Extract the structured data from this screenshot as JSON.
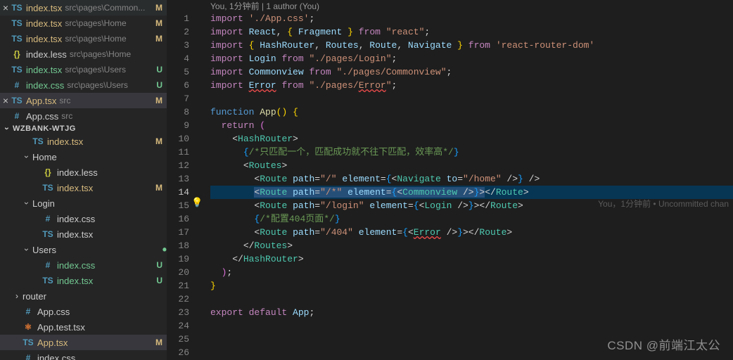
{
  "open_editors": [
    {
      "icon": "TS",
      "iconCls": "ico-ts",
      "name": "index.tsx",
      "path": "src\\pages\\Common...",
      "badge": "M",
      "status": "mod",
      "pad": 1
    },
    {
      "icon": "TS",
      "iconCls": "ico-ts",
      "name": "index.tsx",
      "path": "src\\pages\\Home",
      "badge": "M",
      "status": "mod",
      "pad": 1
    },
    {
      "icon": "TS",
      "iconCls": "ico-ts",
      "name": "index.tsx",
      "path": "src\\pages\\Home",
      "badge": "M",
      "status": "mod",
      "pad": 1
    },
    {
      "icon": "{}",
      "iconCls": "ico-less",
      "name": "index.less",
      "path": "src\\pages\\Home",
      "badge": "",
      "status": "",
      "pad": 1
    },
    {
      "icon": "TS",
      "iconCls": "ico-ts",
      "name": "index.tsx",
      "path": "src\\pages\\Users",
      "badge": "U",
      "status": "unt",
      "pad": 1
    },
    {
      "icon": "#",
      "iconCls": "ico-css",
      "name": "index.css",
      "path": "src\\pages\\Users",
      "badge": "U",
      "status": "unt",
      "pad": 1
    },
    {
      "icon": "TS",
      "iconCls": "ico-ts",
      "name": "App.tsx",
      "path": "src",
      "badge": "M",
      "status": "mod",
      "pad": 1,
      "active": true
    },
    {
      "icon": "#",
      "iconCls": "ico-css",
      "name": "App.css",
      "path": "src",
      "badge": "",
      "status": "",
      "pad": 1
    }
  ],
  "project_name": "WZBANK-WTJG",
  "tree": [
    {
      "type": "file",
      "icon": "TS",
      "iconCls": "ico-ts",
      "name": "index.tsx",
      "badge": "M",
      "status": "mod",
      "pad": 2
    },
    {
      "type": "folder",
      "open": true,
      "name": "Home",
      "pad": 2
    },
    {
      "type": "file",
      "icon": "{}",
      "iconCls": "ico-less",
      "name": "index.less",
      "badge": "",
      "status": "",
      "pad": 3
    },
    {
      "type": "file",
      "icon": "TS",
      "iconCls": "ico-ts",
      "name": "index.tsx",
      "badge": "M",
      "status": "mod",
      "pad": 3
    },
    {
      "type": "folder",
      "open": true,
      "name": "Login",
      "pad": 2
    },
    {
      "type": "file",
      "icon": "#",
      "iconCls": "ico-css",
      "name": "index.css",
      "badge": "",
      "status": "",
      "pad": 3
    },
    {
      "type": "file",
      "icon": "TS",
      "iconCls": "ico-ts",
      "name": "index.tsx",
      "badge": "",
      "status": "",
      "pad": 3
    },
    {
      "type": "folder",
      "open": true,
      "name": "Users",
      "pad": 2,
      "dot": true
    },
    {
      "type": "file",
      "icon": "#",
      "iconCls": "ico-css",
      "name": "index.css",
      "badge": "U",
      "status": "unt",
      "pad": 3
    },
    {
      "type": "file",
      "icon": "TS",
      "iconCls": "ico-ts",
      "name": "index.tsx",
      "badge": "U",
      "status": "unt",
      "pad": 3
    },
    {
      "type": "folder",
      "open": false,
      "name": "router",
      "pad": 1
    },
    {
      "type": "file",
      "icon": "#",
      "iconCls": "ico-css",
      "name": "App.css",
      "badge": "",
      "status": "",
      "pad": 1
    },
    {
      "type": "file",
      "icon": "⚛",
      "iconCls": "ico-test",
      "name": "App.test.tsx",
      "badge": "",
      "status": "",
      "pad": 1
    },
    {
      "type": "file",
      "icon": "TS",
      "iconCls": "ico-ts",
      "name": "App.tsx",
      "badge": "M",
      "status": "mod",
      "pad": 1,
      "active": true
    },
    {
      "type": "file",
      "icon": "#",
      "iconCls": "ico-css",
      "name": "index.css",
      "badge": "",
      "status": "",
      "pad": 1
    }
  ],
  "codelens": "You, 1分钟前 | 1 author (You)",
  "blame": "You，1分钟前 • Uncommitted chan",
  "watermark": "CSDN @前端江太公",
  "code": [
    {
      "n": 1,
      "segs": [
        [
          "kw",
          "import"
        ],
        [
          "pn",
          " "
        ],
        [
          "str",
          "'./App.css'"
        ],
        [
          "pn",
          ";"
        ]
      ]
    },
    {
      "n": 2,
      "segs": [
        [
          "kw",
          "import"
        ],
        [
          "pn",
          " "
        ],
        [
          "var",
          "React"
        ],
        [
          "pn",
          ", "
        ],
        [
          "br1",
          "{"
        ],
        [
          "pn",
          " "
        ],
        [
          "var",
          "Fragment"
        ],
        [
          "pn",
          " "
        ],
        [
          "br1",
          "}"
        ],
        [
          "pn",
          " "
        ],
        [
          "kw",
          "from"
        ],
        [
          "pn",
          " "
        ],
        [
          "str",
          "\"react\""
        ],
        [
          "pn",
          ";"
        ]
      ]
    },
    {
      "n": 3,
      "segs": [
        [
          "kw",
          "import"
        ],
        [
          "pn",
          " "
        ],
        [
          "br1",
          "{"
        ],
        [
          "pn",
          " "
        ],
        [
          "var",
          "HashRouter"
        ],
        [
          "pn",
          ", "
        ],
        [
          "var",
          "Routes"
        ],
        [
          "pn",
          ", "
        ],
        [
          "var",
          "Route"
        ],
        [
          "pn",
          ", "
        ],
        [
          "var",
          "Navigate"
        ],
        [
          "pn",
          " "
        ],
        [
          "br1",
          "}"
        ],
        [
          "pn",
          " "
        ],
        [
          "kw",
          "from"
        ],
        [
          "pn",
          " "
        ],
        [
          "str",
          "'react-router-dom'"
        ]
      ]
    },
    {
      "n": 4,
      "segs": [
        [
          "kw",
          "import"
        ],
        [
          "pn",
          " "
        ],
        [
          "var",
          "Login"
        ],
        [
          "pn",
          " "
        ],
        [
          "kw",
          "from"
        ],
        [
          "pn",
          " "
        ],
        [
          "str",
          "\"./pages/Login\""
        ],
        [
          "pn",
          ";"
        ]
      ]
    },
    {
      "n": 5,
      "segs": [
        [
          "kw",
          "import"
        ],
        [
          "pn",
          " "
        ],
        [
          "var",
          "Commonview"
        ],
        [
          "pn",
          " "
        ],
        [
          "kw",
          "from"
        ],
        [
          "pn",
          " "
        ],
        [
          "str",
          "\"./pages/Commonview\""
        ],
        [
          "pn",
          ";"
        ]
      ]
    },
    {
      "n": 6,
      "segs": [
        [
          "kw",
          "import"
        ],
        [
          "pn",
          " "
        ],
        [
          "var decor",
          "Error"
        ],
        [
          "pn",
          " "
        ],
        [
          "kw",
          "from"
        ],
        [
          "pn",
          " "
        ],
        [
          "str",
          "\"./pages/"
        ],
        [
          "str decor",
          "Error"
        ],
        [
          "str",
          "\""
        ],
        [
          "pn",
          ";"
        ]
      ]
    },
    {
      "n": 7,
      "segs": []
    },
    {
      "n": 8,
      "segs": [
        [
          "tag",
          "function"
        ],
        [
          "pn",
          " "
        ],
        [
          "fn",
          "App"
        ],
        [
          "br1",
          "()"
        ],
        [
          "pn",
          " "
        ],
        [
          "br1",
          "{"
        ]
      ]
    },
    {
      "n": 9,
      "segs": [
        [
          "pn",
          "  "
        ],
        [
          "kw",
          "return"
        ],
        [
          "pn",
          " "
        ],
        [
          "br2",
          "("
        ]
      ]
    },
    {
      "n": 10,
      "segs": [
        [
          "pn",
          "    "
        ],
        [
          "pn",
          "<"
        ],
        [
          "cmp",
          "HashRouter"
        ],
        [
          "pn",
          ">"
        ]
      ]
    },
    {
      "n": 11,
      "segs": [
        [
          "pn",
          "      "
        ],
        [
          "br3",
          "{"
        ],
        [
          "cmt",
          "/*只匹配一个，匹配成功就不往下匹配，效率高*/"
        ],
        [
          "br3",
          "}"
        ]
      ]
    },
    {
      "n": 12,
      "segs": [
        [
          "pn",
          "      "
        ],
        [
          "pn",
          "<"
        ],
        [
          "cmp",
          "Routes"
        ],
        [
          "pn",
          ">"
        ]
      ]
    },
    {
      "n": 13,
      "segs": [
        [
          "pn",
          "        "
        ],
        [
          "pn",
          "<"
        ],
        [
          "cmp",
          "Route"
        ],
        [
          "pn",
          " "
        ],
        [
          "var",
          "path"
        ],
        [
          "pn",
          "="
        ],
        [
          "str",
          "\"/\""
        ],
        [
          "pn",
          " "
        ],
        [
          "var",
          "element"
        ],
        [
          "pn",
          "="
        ],
        [
          "br3",
          "{"
        ],
        [
          "pn",
          "<"
        ],
        [
          "cmp",
          "Navigate"
        ],
        [
          "pn",
          " "
        ],
        [
          "var",
          "to"
        ],
        [
          "pn",
          "="
        ],
        [
          "str",
          "\"/home\""
        ],
        [
          "pn",
          " />"
        ],
        [
          "br3",
          "}"
        ],
        [
          "pn",
          " />"
        ]
      ]
    },
    {
      "n": 14,
      "hl": true,
      "segs": [
        [
          "pn",
          "        "
        ],
        [
          "pn boxsel",
          "<"
        ],
        [
          "cmp boxsel",
          "Route"
        ],
        [
          "pn boxsel",
          " "
        ],
        [
          "var boxsel",
          "path"
        ],
        [
          "pn boxsel",
          "="
        ],
        [
          "str boxsel",
          "\"/*\""
        ],
        [
          "pn boxsel",
          " "
        ],
        [
          "var boxsel",
          "element"
        ],
        [
          "pn boxsel",
          "="
        ],
        [
          "br3 boxsel",
          "{"
        ],
        [
          "pn boxsel",
          "<"
        ],
        [
          "cmp boxsel",
          "Commonview"
        ],
        [
          "pn boxsel",
          " />"
        ],
        [
          "br3 boxsel",
          "}"
        ],
        [
          "pn boxsel",
          ">"
        ],
        [
          "pn",
          "</"
        ],
        [
          "cmp",
          "Route"
        ],
        [
          "pn",
          ">"
        ]
      ]
    },
    {
      "n": 15,
      "segs": [
        [
          "pn",
          "        "
        ],
        [
          "pn",
          "<"
        ],
        [
          "cmp",
          "Route"
        ],
        [
          "pn",
          " "
        ],
        [
          "var",
          "path"
        ],
        [
          "pn",
          "="
        ],
        [
          "str",
          "\"/login\""
        ],
        [
          "pn",
          " "
        ],
        [
          "var",
          "element"
        ],
        [
          "pn",
          "="
        ],
        [
          "br3",
          "{"
        ],
        [
          "pn",
          "<"
        ],
        [
          "cmp",
          "Login"
        ],
        [
          "pn",
          " />"
        ],
        [
          "br3",
          "}"
        ],
        [
          "pn",
          "></"
        ],
        [
          "cmp",
          "Route"
        ],
        [
          "pn",
          ">"
        ]
      ]
    },
    {
      "n": 16,
      "segs": [
        [
          "pn",
          "        "
        ],
        [
          "br3",
          "{"
        ],
        [
          "cmt",
          "/*配置404页面*/"
        ],
        [
          "br3",
          "}"
        ]
      ]
    },
    {
      "n": 17,
      "segs": [
        [
          "pn",
          "        "
        ],
        [
          "pn",
          "<"
        ],
        [
          "cmp",
          "Route"
        ],
        [
          "pn",
          " "
        ],
        [
          "var",
          "path"
        ],
        [
          "pn",
          "="
        ],
        [
          "str",
          "\"/404\""
        ],
        [
          "pn",
          " "
        ],
        [
          "var",
          "element"
        ],
        [
          "pn",
          "="
        ],
        [
          "br3",
          "{"
        ],
        [
          "pn",
          "<"
        ],
        [
          "cmp decor",
          "Error"
        ],
        [
          "pn",
          " />"
        ],
        [
          "br3",
          "}"
        ],
        [
          "pn",
          "></"
        ],
        [
          "cmp",
          "Route"
        ],
        [
          "pn",
          ">"
        ]
      ]
    },
    {
      "n": 18,
      "segs": [
        [
          "pn",
          "      "
        ],
        [
          "pn",
          "</"
        ],
        [
          "cmp",
          "Routes"
        ],
        [
          "pn",
          ">"
        ]
      ]
    },
    {
      "n": 19,
      "segs": [
        [
          "pn",
          "    "
        ],
        [
          "pn",
          "</"
        ],
        [
          "cmp",
          "HashRouter"
        ],
        [
          "pn",
          ">"
        ]
      ]
    },
    {
      "n": 20,
      "segs": [
        [
          "pn",
          "  "
        ],
        [
          "br2",
          ")"
        ],
        [
          "pn",
          ";"
        ]
      ]
    },
    {
      "n": 21,
      "segs": [
        [
          "br1",
          "}"
        ]
      ]
    },
    {
      "n": 22,
      "segs": []
    },
    {
      "n": 23,
      "segs": [
        [
          "kw",
          "export"
        ],
        [
          "pn",
          " "
        ],
        [
          "kw",
          "default"
        ],
        [
          "pn",
          " "
        ],
        [
          "var",
          "App"
        ],
        [
          "pn",
          ";"
        ]
      ]
    },
    {
      "n": 24,
      "segs": []
    },
    {
      "n": 25,
      "segs": []
    },
    {
      "n": 26,
      "segs": []
    }
  ]
}
